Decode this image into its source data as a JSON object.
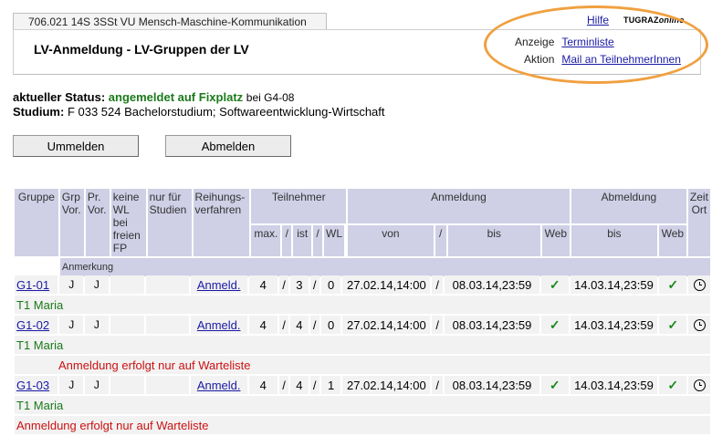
{
  "course_tab": "706.021 14S 3SSt VU Mensch-Maschine-Kommunikation",
  "page_title": "LV-Anmeldung - LV-Gruppen der LV",
  "header": {
    "help": "Hilfe",
    "logo_main": "TUGRAZ",
    "logo_online": "online"
  },
  "actions": {
    "anzeige_label": "Anzeige",
    "anzeige_link": "Terminliste",
    "aktion_label": "Aktion",
    "aktion_link": "Mail an TeilnehmerInnen"
  },
  "status": {
    "label": "aktueller Status:",
    "value": "angemeldet auf Fixplatz",
    "bei": "bei G4-08",
    "studium_label": "Studium:",
    "studium_value": "F 033 524 Bachelorstudium; Softwareentwicklung-Wirtschaft"
  },
  "buttons": {
    "ummelden": "Ummelden",
    "abmelden": "Abmelden"
  },
  "table": {
    "headers": {
      "gruppe": "Gruppe",
      "grp_vor": "Grp Vor.",
      "pr_vor": "Pr. Vor.",
      "keine_wl": "keine WL bei freien FP",
      "nur_fuer": "nur für Studien",
      "reihung": "Reihungs-verfahren",
      "teilnehmer": "Teilnehmer",
      "anmeldung": "Anmeldung",
      "abmeldung": "Abmeldung",
      "zeit_ort": "Zeit Ort",
      "max": "max.",
      "slash": "/",
      "ist": "ist",
      "wl": "WL",
      "von": "von",
      "bis": "bis",
      "web": "Web"
    },
    "anmerkung": "Anmerkung",
    "rows": [
      {
        "gruppe": "G1-01",
        "grp_vor": "J",
        "pr_vor": "J",
        "reihung": "Anmeld.",
        "max": "4",
        "ist": "3",
        "wl": "0",
        "von": "27.02.14,14:00",
        "bis": "08.03.14,23:59",
        "abm_bis": "14.03.14,23:59",
        "teacher": "T1 Maria",
        "note": ""
      },
      {
        "gruppe": "G1-02",
        "grp_vor": "J",
        "pr_vor": "J",
        "reihung": "Anmeld.",
        "max": "4",
        "ist": "4",
        "wl": "0",
        "von": "27.02.14,14:00",
        "bis": "08.03.14,23:59",
        "abm_bis": "14.03.14,23:59",
        "teacher": "T1 Maria",
        "note": "Anmeldung erfolgt nur auf Warteliste"
      },
      {
        "gruppe": "G1-03",
        "grp_vor": "J",
        "pr_vor": "J",
        "reihung": "Anmeld.",
        "max": "4",
        "ist": "4",
        "wl": "1",
        "von": "27.02.14,14:00",
        "bis": "08.03.14,23:59",
        "abm_bis": "14.03.14,23:59",
        "teacher": "T1 Maria",
        "note": "Anmeldung erfolgt nur auf Warteliste"
      }
    ],
    "check_glyph": "✓"
  }
}
